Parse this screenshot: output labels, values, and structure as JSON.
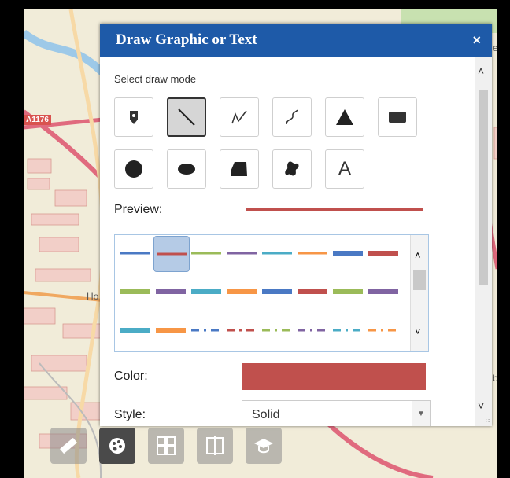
{
  "map": {
    "road_label": "A1176",
    "place_fragment": "Ho",
    "edge_fragment_1": "es",
    "edge_fragment_2": "be"
  },
  "panel": {
    "title": "Draw Graphic or Text",
    "close_glyph": "×",
    "select_mode_label": "Select draw mode",
    "draw_modes": [
      {
        "name": "point",
        "icon": "map-pin-icon",
        "selected": false
      },
      {
        "name": "line",
        "icon": "line-icon",
        "selected": true
      },
      {
        "name": "polyline",
        "icon": "polyline-icon",
        "selected": false
      },
      {
        "name": "freehand-polyline",
        "icon": "freehand-line-icon",
        "selected": false
      },
      {
        "name": "triangle",
        "icon": "triangle-icon",
        "selected": false
      },
      {
        "name": "rectangle",
        "icon": "rectangle-icon",
        "selected": false
      },
      {
        "name": "circle",
        "icon": "circle-icon",
        "selected": false
      },
      {
        "name": "ellipse",
        "icon": "ellipse-icon",
        "selected": false
      },
      {
        "name": "polygon",
        "icon": "polygon-icon",
        "selected": false
      },
      {
        "name": "freehand-polygon",
        "icon": "freehand-polygon-icon",
        "selected": false
      },
      {
        "name": "text",
        "icon": "text-icon",
        "label": "A",
        "selected": false
      }
    ],
    "preview_label": "Preview:",
    "color_label": "Color:",
    "style_label": "Style:",
    "style_value": "Solid",
    "selected_color": "#c0504d",
    "swatches": [
      {
        "color": "#4a79c4",
        "dash": "solid"
      },
      {
        "color": "#c0504d",
        "dash": "solid",
        "selected": true
      },
      {
        "color": "#9bbb59",
        "dash": "solid"
      },
      {
        "color": "#8064a2",
        "dash": "solid"
      },
      {
        "color": "#4bacc6",
        "dash": "solid"
      },
      {
        "color": "#f79646",
        "dash": "solid"
      },
      {
        "color": "#4a79c4",
        "dash": "solid-thick"
      },
      {
        "color": "#c0504d",
        "dash": "solid-thick"
      },
      {
        "color": "#9bbb59",
        "dash": "solid-thick"
      },
      {
        "color": "#8064a2",
        "dash": "solid-thick"
      },
      {
        "color": "#4bacc6",
        "dash": "solid-thick"
      },
      {
        "color": "#f79646",
        "dash": "solid-thick"
      },
      {
        "color": "#4a79c4",
        "dash": "solid-thick"
      },
      {
        "color": "#c0504d",
        "dash": "solid-thick"
      },
      {
        "color": "#9bbb59",
        "dash": "solid-thick"
      },
      {
        "color": "#8064a2",
        "dash": "solid-thick"
      },
      {
        "color": "#4bacc6",
        "dash": "solid-thick"
      },
      {
        "color": "#f79646",
        "dash": "solid-thick"
      },
      {
        "color": "#4a79c4",
        "dash": "dash-dot"
      },
      {
        "color": "#c0504d",
        "dash": "dash-dot"
      },
      {
        "color": "#9bbb59",
        "dash": "dash-dot"
      },
      {
        "color": "#8064a2",
        "dash": "dash-dot"
      },
      {
        "color": "#4bacc6",
        "dash": "dash-dot"
      },
      {
        "color": "#f79646",
        "dash": "dash-dot"
      }
    ]
  },
  "toolbar": [
    {
      "name": "measure",
      "icon": "ruler-icon",
      "active": false
    },
    {
      "name": "draw",
      "icon": "palette-icon",
      "active": true
    },
    {
      "name": "basemap-gallery",
      "icon": "basemap-grid-icon",
      "active": false
    },
    {
      "name": "swipe",
      "icon": "swipe-icon",
      "active": false
    },
    {
      "name": "about",
      "icon": "graduation-cap-icon",
      "active": false
    }
  ]
}
